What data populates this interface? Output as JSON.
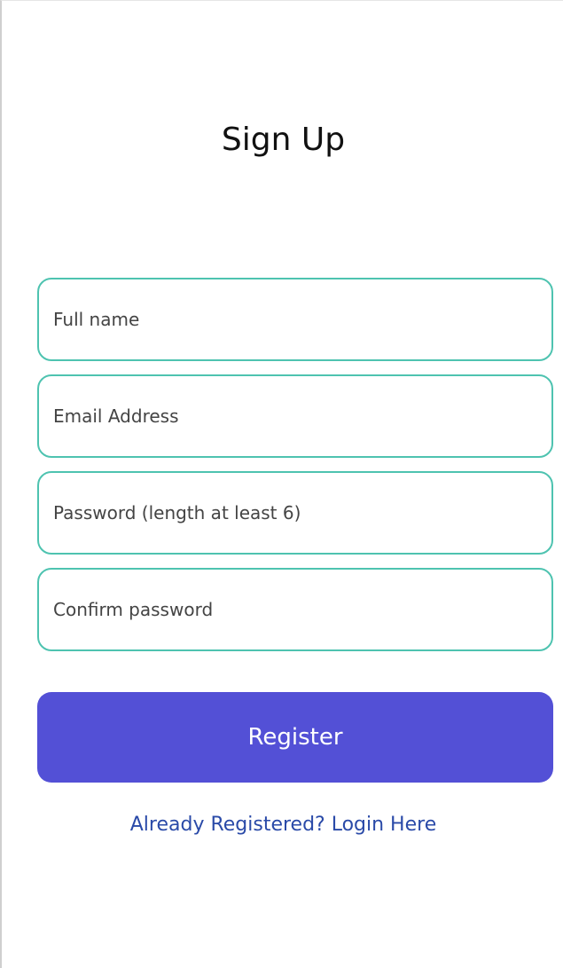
{
  "page": {
    "title": "Sign Up"
  },
  "form": {
    "full_name_placeholder": "Full name",
    "email_placeholder": "Email Address",
    "password_placeholder": "Password (length at least 6)",
    "confirm_password_placeholder": "Confirm password",
    "register_label": "Register",
    "login_link_label": "Already Registered? Login Here"
  },
  "colors": {
    "field_border": "#4ec3b0",
    "button_bg": "#5350d6",
    "link": "#2a4aa8"
  }
}
